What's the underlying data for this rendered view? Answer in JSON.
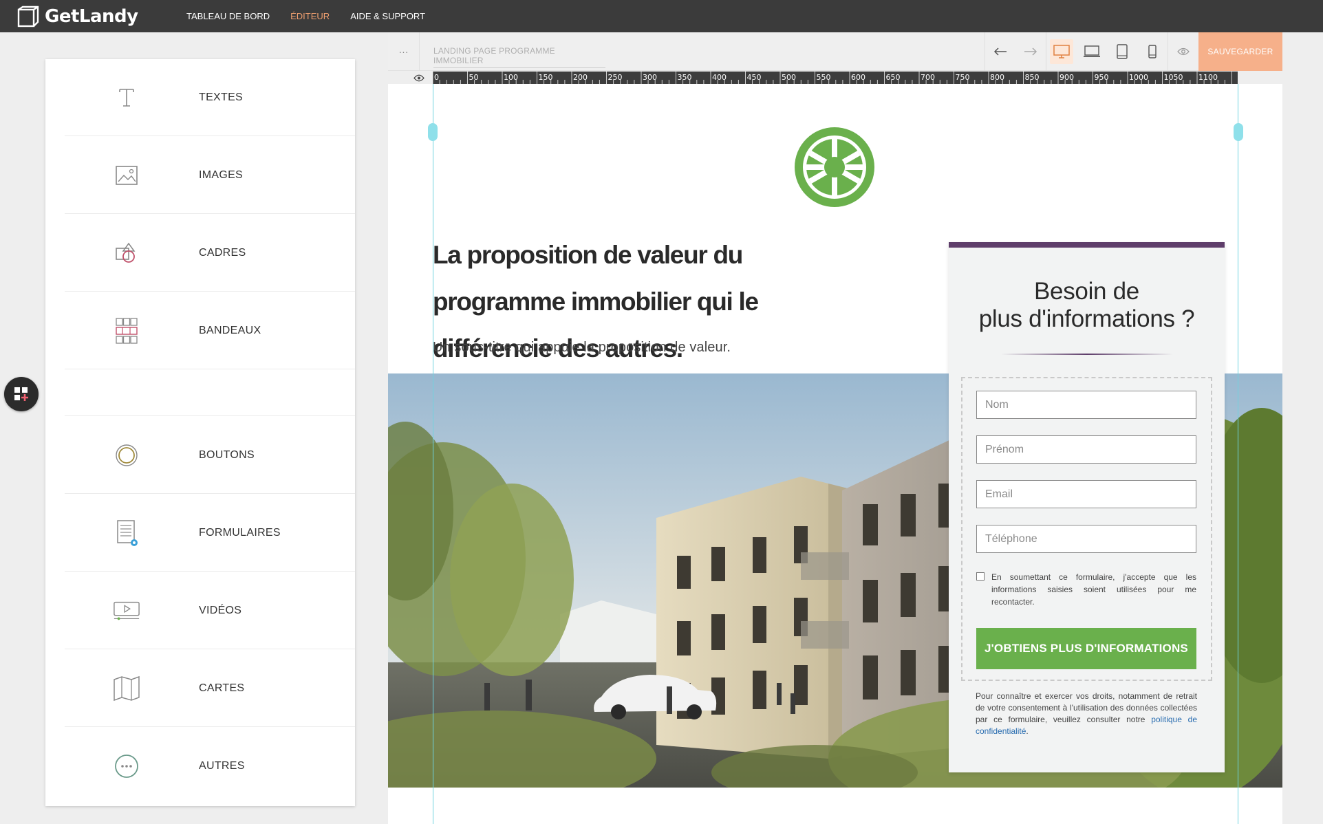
{
  "topbar": {
    "logo_text": "GetLandy",
    "nav": [
      {
        "label": "TABLEAU DE BORD"
      },
      {
        "label": "ÉDITEUR"
      },
      {
        "label": "AIDE & SUPPORT"
      }
    ]
  },
  "sidebar": {
    "items": [
      {
        "label": "TEXTES",
        "icon": "text-icon"
      },
      {
        "label": "IMAGES",
        "icon": "image-icon"
      },
      {
        "label": "CADRES",
        "icon": "shapes-icon"
      },
      {
        "label": "BANDEAUX",
        "icon": "grid-icon"
      },
      {
        "label": "BOUTONS",
        "icon": "button-circle-icon"
      },
      {
        "label": "FORMULAIRES",
        "icon": "form-icon"
      },
      {
        "label": "VIDÉOS",
        "icon": "video-icon"
      },
      {
        "label": "CARTES",
        "icon": "map-icon"
      },
      {
        "label": "AUTRES",
        "icon": "more-icon"
      }
    ]
  },
  "toolbar": {
    "dots_label": "···",
    "page_name": "LANDING PAGE PROGRAMME IMMOBILIER",
    "save_label": "SAUVEGARDER"
  },
  "ruler": {
    "labels": [
      "0",
      "50",
      "100",
      "150",
      "200",
      "250",
      "300",
      "350",
      "400",
      "450",
      "500",
      "550",
      "600",
      "650",
      "700",
      "750",
      "800",
      "850",
      "900",
      "950",
      "1000",
      "1050",
      "1100"
    ]
  },
  "page": {
    "hero_title": "La proposition de valeur du programme immobilier qui le différencie des autres.",
    "hero_subtitle": "Un sous-titre qui appuie la proposition de valeur.",
    "form": {
      "title_line1": "Besoin de",
      "title_line2": "plus d'informations ?",
      "fields": {
        "nom": "Nom",
        "prenom": "Prénom",
        "email": "Email",
        "telephone": "Téléphone"
      },
      "consent_text": "En soumettant ce formulaire, j'accepte que les informations saisies soient utilisées pour me recontacter.",
      "submit_label": "J'OBTIENS PLUS D'INFORMATIONS",
      "legal_text": "Pour connaître et exercer vos droits, notamment de retrait de votre consentement à l'utilisation des données collectées par ce formulaire, veuillez consulter notre ",
      "legal_link": "politique de confidentialité",
      "legal_end": "."
    }
  },
  "colors": {
    "topbar_bg": "#3b3b3b",
    "nav_active": "#f0a070",
    "save_bg": "#f6b08a",
    "form_accent": "#5e3d6a",
    "submit_bg": "#6ab04c",
    "logo_green": "#6ab04c",
    "guide_cyan": "#6fd3df"
  }
}
